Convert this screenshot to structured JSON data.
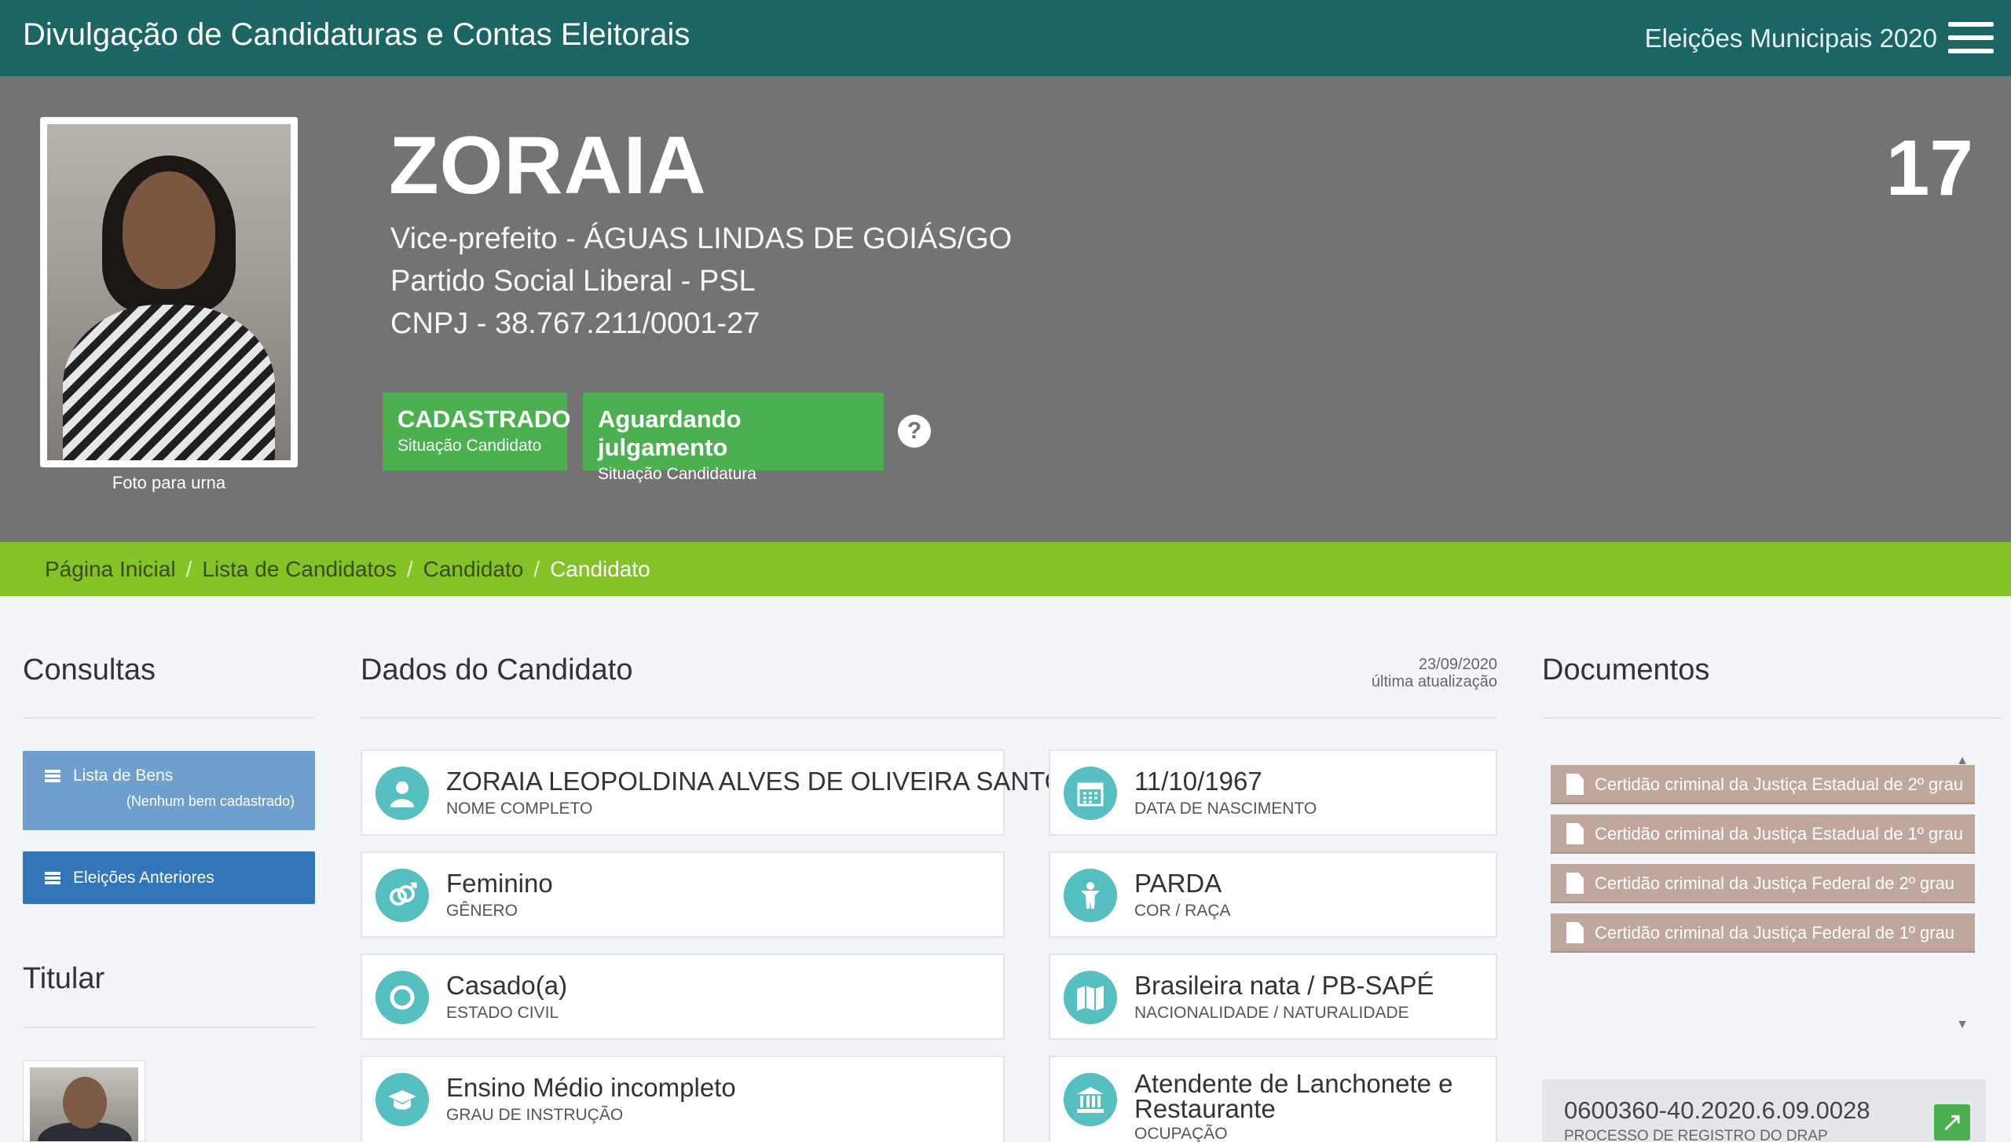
{
  "topbar": {
    "title": "Divulgação de Candidaturas e Contas Eleitorais",
    "election": "Eleições Municipais 2020"
  },
  "profile": {
    "photo_caption": "Foto para urna",
    "name": "ZORAIA",
    "number": "17",
    "office": "Vice-prefeito - ÁGUAS LINDAS DE GOIÁS/GO",
    "party": "Partido Social Liberal - PSL",
    "cnpj": "CNPJ - 38.767.211/0001-27",
    "status_candidate": {
      "value": "CADASTRADO",
      "label": "Situação Candidato"
    },
    "status_candidacy": {
      "value": "Aguardando julgamento",
      "label": "Situação Candidatura"
    },
    "help_symbol": "?"
  },
  "breadcrumb": {
    "items": [
      "Página Inicial",
      "Lista de Candidatos",
      "Candidato"
    ],
    "current": "Candidato",
    "separator": "/"
  },
  "consultas": {
    "title": "Consultas",
    "bens_label": "Lista de Bens",
    "bens_sub": "(Nenhum bem cadastrado)",
    "anteriores_label": "Eleições Anteriores"
  },
  "titular": {
    "title": "Titular"
  },
  "dados": {
    "title": "Dados do Candidato",
    "updated_date": "23/09/2020",
    "updated_label": "última atualização",
    "fields": [
      {
        "value": "ZORAIA LEOPOLDINA ALVES DE OLIVEIRA SANTOS",
        "label": "NOME COMPLETO",
        "icon": "person-icon"
      },
      {
        "value": "11/10/1967",
        "label": "DATA DE NASCIMENTO",
        "icon": "calendar-icon"
      },
      {
        "value": "Feminino",
        "label": "GÊNERO",
        "icon": "gender-icon"
      },
      {
        "value": "PARDA",
        "label": "COR / RAÇA",
        "icon": "figure-icon"
      },
      {
        "value": "Casado(a)",
        "label": "ESTADO CIVIL",
        "icon": "ring-icon"
      },
      {
        "value": "Brasileira nata / PB-SAPÉ",
        "label": "NACIONALIDADE / NATURALIDADE",
        "icon": "map-icon"
      },
      {
        "value": "Ensino Médio incompleto",
        "label": "GRAU DE INSTRUÇÃO",
        "icon": "graduation-cap-icon"
      },
      {
        "value": "Atendente de Lanchonete e Restaurante",
        "label": "OCUPAÇÃO",
        "icon": "building-icon"
      }
    ]
  },
  "documentos": {
    "title": "Documentos",
    "items": [
      "Certidão criminal da Justiça Estadual de 2º grau",
      "Certidão criminal da Justiça Estadual de 1º grau",
      "Certidão criminal da Justiça Federal de 2º grau",
      "Certidão criminal da Justiça Federal de 1º grau"
    ],
    "drap_number": "0600360-40.2020.6.09.0028",
    "drap_label": "PROCESSO DE REGISTRO DO DRAP"
  },
  "colors": {
    "topbar": "#1b6565",
    "header_bg": "#737373",
    "breadcrumb": "#84c225",
    "badge_green": "#4caf50",
    "btn_light_blue": "#6e9fcf",
    "btn_blue": "#3276b8",
    "icon_teal": "#56bfbf",
    "doc_item": "#c0a79e"
  }
}
